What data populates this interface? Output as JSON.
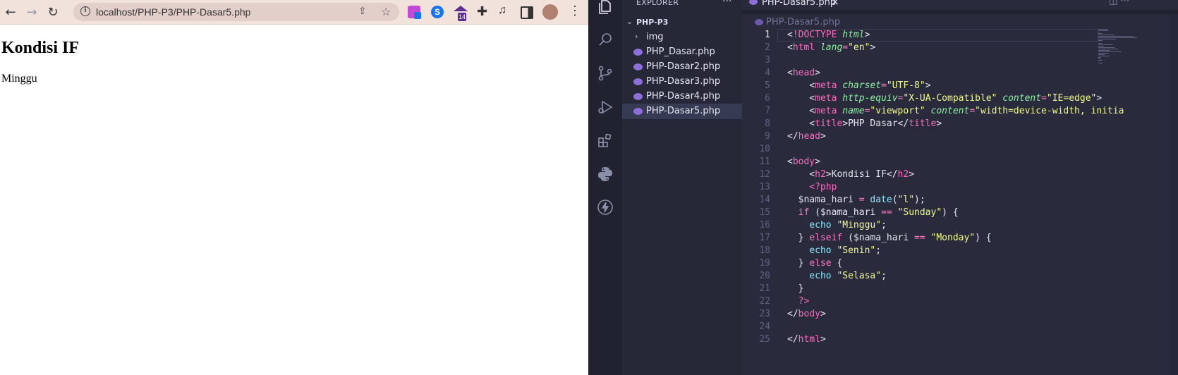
{
  "browser": {
    "url": "localhost/PHP-P3/PHP-Dasar5.php",
    "extensions": [
      {
        "name": "extension-puzzle-pink",
        "color": "#c24ad6"
      },
      {
        "name": "extension-blue-s",
        "color": "#1a73e8"
      },
      {
        "name": "extension-school",
        "color": "#5b2d8e",
        "badge": "14"
      },
      {
        "name": "extensions-icon",
        "color": "#444444"
      },
      {
        "name": "media-control-icon",
        "color": "#444444"
      },
      {
        "name": "side-panel-icon",
        "color": "#444444"
      },
      {
        "name": "profile-avatar",
        "color": "#b08070"
      },
      {
        "name": "menu-icon",
        "color": "#444444"
      }
    ],
    "page": {
      "heading": "Kondisi IF",
      "text": "Minggu"
    }
  },
  "vscode": {
    "explorer_title": "EXPLORER",
    "folder": "PHP-P3",
    "tree": [
      {
        "label": "img",
        "type": "folder"
      },
      {
        "label": "PHP_Dasar.php",
        "type": "php"
      },
      {
        "label": "PHP-Dasar2.php",
        "type": "php"
      },
      {
        "label": "PHP-Dasar3.php",
        "type": "php"
      },
      {
        "label": "PHP-Dasar4.php",
        "type": "php"
      },
      {
        "label": "PHP-Dasar5.php",
        "type": "php",
        "active": true
      }
    ],
    "tab": {
      "label": "PHP-Dasar5.php",
      "close": "×"
    },
    "breadcrumb": "PHP-Dasar5.php",
    "current_line": 1,
    "lines": [
      [
        [
          "punc",
          "<"
        ],
        [
          "tag",
          "!DOCTYPE "
        ],
        [
          "attr",
          "html"
        ],
        [
          "punc",
          ">"
        ]
      ],
      [
        [
          "punc",
          "<"
        ],
        [
          "tag",
          "html "
        ],
        [
          "attr",
          "lang"
        ],
        [
          "op",
          "="
        ],
        [
          "str",
          "\"en\""
        ],
        [
          "punc",
          ">"
        ]
      ],
      [],
      [
        [
          "punc",
          "<"
        ],
        [
          "tag",
          "head"
        ],
        [
          "punc",
          ">"
        ]
      ],
      [
        [
          "punc",
          "    <"
        ],
        [
          "tag",
          "meta "
        ],
        [
          "attr",
          "charset"
        ],
        [
          "op",
          "="
        ],
        [
          "str",
          "\"UTF-8\""
        ],
        [
          "punc",
          ">"
        ]
      ],
      [
        [
          "punc",
          "    <"
        ],
        [
          "tag",
          "meta "
        ],
        [
          "attr",
          "http-equiv"
        ],
        [
          "op",
          "="
        ],
        [
          "str",
          "\"X-UA-Compatible\" "
        ],
        [
          "attr",
          "content"
        ],
        [
          "op",
          "="
        ],
        [
          "str",
          "\"IE=edge\""
        ],
        [
          "punc",
          ">"
        ]
      ],
      [
        [
          "punc",
          "    <"
        ],
        [
          "tag",
          "meta "
        ],
        [
          "attr",
          "name"
        ],
        [
          "op",
          "="
        ],
        [
          "str",
          "\"viewport\" "
        ],
        [
          "attr",
          "content"
        ],
        [
          "op",
          "="
        ],
        [
          "str",
          "\"width=device-width, initia"
        ]
      ],
      [
        [
          "punc",
          "    <"
        ],
        [
          "tag",
          "title"
        ],
        [
          "punc",
          ">PHP Dasar</"
        ],
        [
          "tag",
          "title"
        ],
        [
          "punc",
          ">"
        ]
      ],
      [
        [
          "punc",
          "</"
        ],
        [
          "tag",
          "head"
        ],
        [
          "punc",
          ">"
        ]
      ],
      [],
      [
        [
          "punc",
          "<"
        ],
        [
          "tag",
          "body"
        ],
        [
          "punc",
          ">"
        ]
      ],
      [
        [
          "punc",
          "    <"
        ],
        [
          "tag",
          "h2"
        ],
        [
          "punc",
          ">Kondisi IF</"
        ],
        [
          "tag",
          "h2"
        ],
        [
          "punc",
          ">"
        ]
      ],
      [
        [
          "tag",
          "    <?php"
        ]
      ],
      [
        [
          "var",
          "  $nama_hari "
        ],
        [
          "op",
          "= "
        ],
        [
          "fn",
          "date"
        ],
        [
          "punc",
          "("
        ],
        [
          "str",
          "\"l\""
        ],
        [
          "punc",
          ");"
        ]
      ],
      [
        [
          "kw",
          "  if "
        ],
        [
          "punc",
          "("
        ],
        [
          "var",
          "$nama_hari "
        ],
        [
          "op",
          "== "
        ],
        [
          "str",
          "\"Sunday\""
        ],
        [
          "punc",
          ") {"
        ]
      ],
      [
        [
          "fn",
          "    echo "
        ],
        [
          "str",
          "\"Minggu\""
        ],
        [
          "punc",
          ";"
        ]
      ],
      [
        [
          "punc",
          "  } "
        ],
        [
          "kw",
          "elseif "
        ],
        [
          "punc",
          "("
        ],
        [
          "var",
          "$nama_hari "
        ],
        [
          "op",
          "== "
        ],
        [
          "str",
          "\"Monday\""
        ],
        [
          "punc",
          ") {"
        ]
      ],
      [
        [
          "fn",
          "    echo "
        ],
        [
          "str",
          "\"Senin\""
        ],
        [
          "punc",
          ";"
        ]
      ],
      [
        [
          "punc",
          "  } "
        ],
        [
          "kw",
          "else "
        ],
        [
          "punc",
          "{"
        ]
      ],
      [
        [
          "fn",
          "    echo "
        ],
        [
          "str",
          "\"Selasa\""
        ],
        [
          "punc",
          ";"
        ]
      ],
      [
        [
          "punc",
          "  }"
        ]
      ],
      [
        [
          "tag",
          "  ?>"
        ]
      ],
      [
        [
          "punc",
          "</"
        ],
        [
          "tag",
          "body"
        ],
        [
          "punc",
          ">"
        ]
      ],
      [],
      [
        [
          "punc",
          "</"
        ],
        [
          "tag",
          "html"
        ],
        [
          "punc",
          ">"
        ]
      ]
    ]
  }
}
